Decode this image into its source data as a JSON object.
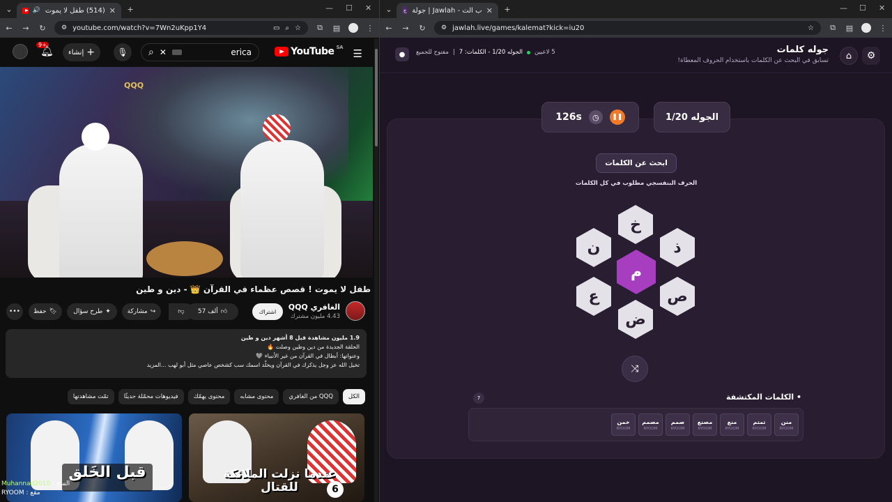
{
  "left_browser": {
    "tab_title": "(514) طفل لا يموت ! قصص",
    "url": "youtube.com/watch?v=7Wn2uKpp1Y4"
  },
  "right_browser": {
    "tab_title": "جولة | Jawlah - منصة الألعاب الت",
    "url": "jawlah.live/games/kalemat?kick=iu20"
  },
  "youtube": {
    "logo_text": "YouTube",
    "region": "SA",
    "search_value": "erica",
    "create_label": "إنشاء",
    "notif_count": "9+",
    "video_title": "طفل لا يموت ! قصص عظماء في القرآن 👑 - دين و طين",
    "channel_name": "الغافري QQQ",
    "channel_subs": "4.43 مليون مشترك",
    "subscribe_label": "اشتراك",
    "like_count": "57 ألف",
    "share_label": "مشاركة",
    "ask_label": "طرح سؤال",
    "save_label": "حفظ",
    "video_logo": "QQQ",
    "description": {
      "meta": "1.9 مليون مشاهدة  قبل 8 أشهر  دين و طين",
      "line1": "الحلقة الجديدة من دين وطين وصلت 🔥",
      "line2": "وعنوانها: أبطال في القرآن من غير الأنبياء 🩶",
      "line3": "تخيل الله عز وجل يذكرك في القرآن ويخلّد اسمك سب كشخص عاصي مثل أبو لهب ...المزيد"
    },
    "chips": [
      "الكل",
      "من الغافري QQQ",
      "محتوى مشابه",
      "محتوى يهمّك",
      "فيديوهات محمّلة حديثًا",
      "تمّت مشاهدتها"
    ],
    "thumbs": [
      {
        "text": "عندما نزلت الملائكة للقتال",
        "num": "6"
      },
      {
        "text": "قبل الخَلق"
      }
    ],
    "chat": [
      {
        "user": "Muhannad2010",
        "msg": "السح"
      },
      {
        "user": "RYOOM",
        "msg": "مقع"
      }
    ]
  },
  "jawlah": {
    "title": "جوله كلمات",
    "subtitle": "تسابق في البحث عن الكلمات باستخدام الحروف المعطاة!",
    "players": "5 لاعبين",
    "round_info": "الجوله 1/20 - الكلمات: 7",
    "open_label": "مفتوح للجميع",
    "round_box": "الجوله 1/20",
    "timer": "126s",
    "find_button": "ابحث عن الكلمات",
    "hint": "الحرف البنفسجي مطلوب في كل الكلمات",
    "letters": {
      "center": "م",
      "top": "خ",
      "top_right": "ذ",
      "bottom_right": "ص",
      "bottom": "ض",
      "bottom_left": "ع",
      "top_left": "ن"
    },
    "found_heading": "• الكلمات المكتشفة",
    "found_count": "7",
    "found_words": [
      {
        "word": "منن",
        "user": "RYOOM"
      },
      {
        "word": "تمتم",
        "user": "RYOOM"
      },
      {
        "word": "منع",
        "user": "RYOOM"
      },
      {
        "word": "مصنع",
        "user": "RYOOM"
      },
      {
        "word": "صمم",
        "user": "RYOOM"
      },
      {
        "word": "مصمم",
        "user": "RYOOM"
      },
      {
        "word": "خمن",
        "user": "RYOOM"
      }
    ]
  }
}
